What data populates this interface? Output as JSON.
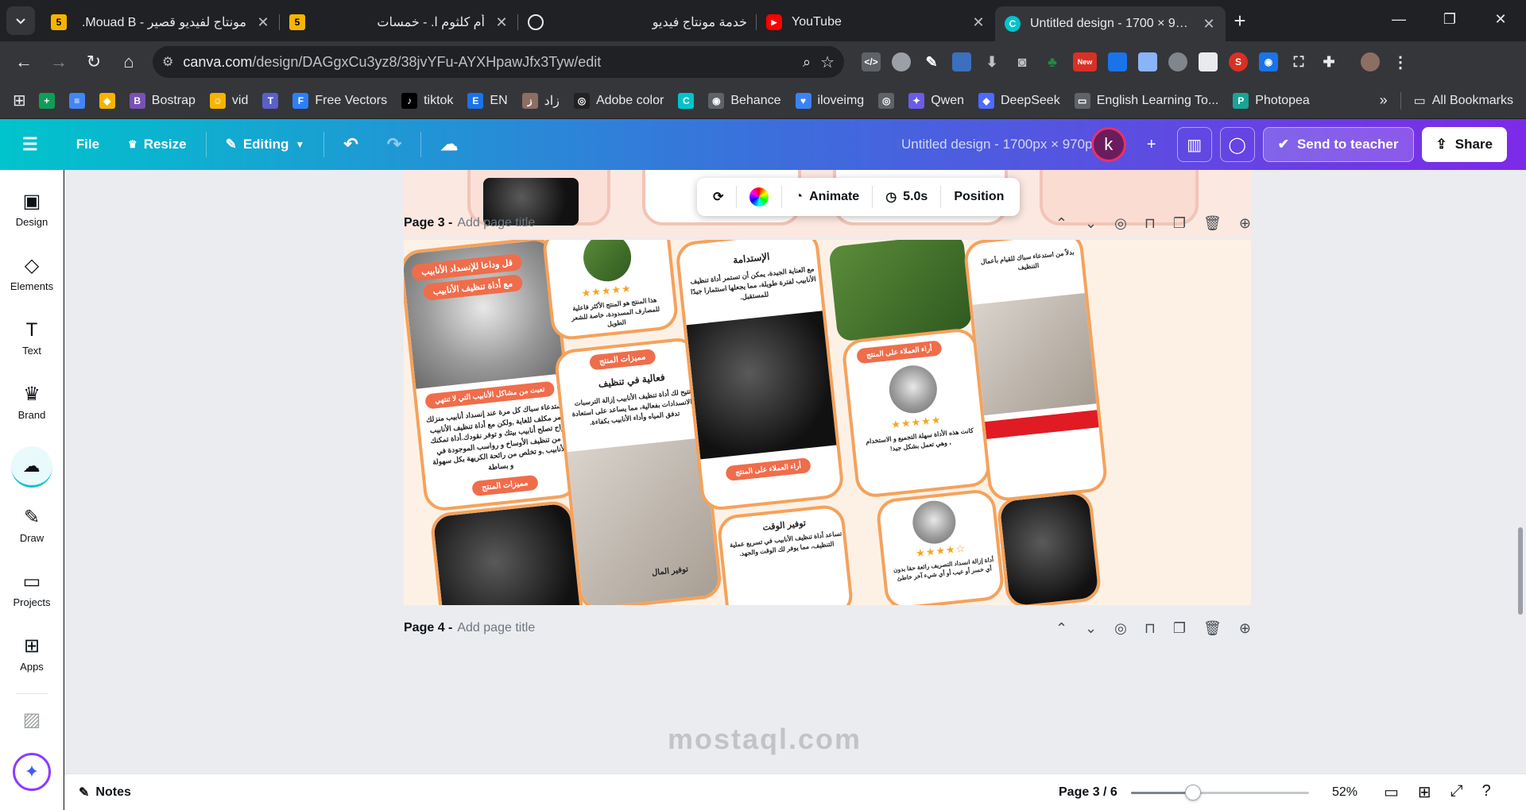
{
  "browser": {
    "tabs": [
      {
        "title": "مونتاج لفيديو قصير - Mouad B.",
        "favicon": "5",
        "favicon_color": "#f5b400"
      },
      {
        "title": "أم كلثوم ا. - خمسات",
        "favicon": "5",
        "favicon_color": "#f5b400"
      },
      {
        "title": "خدمة مونتاج فيديو",
        "favicon": "",
        "favicon_color": "#202124"
      },
      {
        "title": "YouTube",
        "favicon": "▶",
        "favicon_color": "#ff0000"
      },
      {
        "title": "Untitled design - 1700 × 970px",
        "favicon": "C",
        "favicon_color": "#00c4cc"
      }
    ],
    "url_host": "canva.com",
    "url_path": "/design/DAGgxCu3yz8/38jvYFu-AYXHpawJfx3Tyw/edit",
    "extension_badge": "New",
    "bookmarks": [
      {
        "label": "",
        "icon_color": "#0f9d58",
        "glyph": "+"
      },
      {
        "label": "",
        "icon_color": "#4285f4",
        "glyph": "≡"
      },
      {
        "label": "",
        "icon_color": "#f5b400",
        "glyph": "◆"
      },
      {
        "label": "Bostrap",
        "icon_color": "#7952b3",
        "glyph": "B"
      },
      {
        "label": "vid",
        "icon_color": "#f5b400",
        "glyph": "☺"
      },
      {
        "label": "",
        "icon_color": "#5b5fc7",
        "glyph": "T"
      },
      {
        "label": "Free Vectors",
        "icon_color": "#2d7ff9",
        "glyph": "F"
      },
      {
        "label": "tiktok",
        "icon_color": "#000000",
        "glyph": "♪"
      },
      {
        "label": "EN",
        "icon_color": "#1a73e8",
        "glyph": "E"
      },
      {
        "label": "زاد",
        "icon_color": "#8d6e63",
        "glyph": "ز"
      },
      {
        "label": "Adobe color",
        "icon_color": "#222222",
        "glyph": "◎"
      },
      {
        "label": "",
        "icon_color": "#00c4cc",
        "glyph": "C"
      },
      {
        "label": "Behance",
        "icon_color": "#5f6368",
        "glyph": "◉"
      },
      {
        "label": "iloveimg",
        "icon_color": "#3b82f6",
        "glyph": "♥"
      },
      {
        "label": "",
        "icon_color": "#5f6368",
        "glyph": "◎"
      },
      {
        "label": "Qwen",
        "icon_color": "#6b5ce7",
        "glyph": "✦"
      },
      {
        "label": "DeepSeek",
        "icon_color": "#4d6bfe",
        "glyph": "◆"
      },
      {
        "label": "English Learning To...",
        "icon_color": "#5f6368",
        "glyph": "▭"
      },
      {
        "label": "Photopea",
        "icon_color": "#18a497",
        "glyph": "P"
      }
    ],
    "all_bookmarks": "All Bookmarks"
  },
  "canva": {
    "menu": {
      "file": "File",
      "resize": "Resize",
      "editing": "Editing"
    },
    "doc_title": "Untitled design - 1700px × 970px",
    "avatar_letter": "k",
    "send_to_teacher": "Send to teacher",
    "share": "Share",
    "rail": [
      {
        "label": "Design",
        "icon": "▣"
      },
      {
        "label": "Elements",
        "icon": "◇"
      },
      {
        "label": "Text",
        "icon": "T"
      },
      {
        "label": "Brand",
        "icon": "♛"
      },
      {
        "label": "",
        "icon": "☁"
      },
      {
        "label": "Draw",
        "icon": "✎"
      },
      {
        "label": "Projects",
        "icon": "▭"
      },
      {
        "label": "Apps",
        "icon": "⊞"
      }
    ],
    "floating_toolbar": {
      "animate": "Animate",
      "duration": "5.0s",
      "position": "Position"
    },
    "pages": [
      {
        "title": "Page 3 -",
        "add_title": "Add page title"
      },
      {
        "title": "Page 4 -",
        "add_title": "Add page title"
      }
    ],
    "design_text": {
      "headline1": "قل وداعا للإنسداد الأنابيب",
      "headline2": "مع أداة تنظيف الأنابيب",
      "tired": "تعبت من مشاكل الأنابيب التي لا تنتهي",
      "body1": "إستدعاء سباك كل مرة عند إنسداد أنابيب منزلك أمر مكلف للغاية ,ولكن مع أداة تنظيف الأنابيب راح تصلح أنابيب بيتك و توفر نقودك.أداة تمكنك من تنظيف الأوساخ و رواسب الموجودة في الأنابيب ,و تخلص من رائحة الكريهة بكل سهولة و بساطة",
      "features": "مميزات المنتج",
      "effective": "فعالية في تنظيف",
      "effective_body": "تتيح لك أداة تنظيف الأنابيب إزالة الترسبات والانسدادات بفعالية، مما يساعد على استعادة تدفق المياه وأداء الأنابيب بكفاءة.",
      "review1": "هذا المنتج هو المنتج الأكثر فاعلية للمصارف المسدودة، خاصة للشعر الطويل",
      "sustain": "الإستدامة",
      "sustain_body": "مع العناية الجيدة، يمكن أن تستمر أداة تنظيف الأنابيب لفترة طويلة، مما يجعلها استثمارا جيدًا للمستقبل.",
      "opinions": "أراء العملاء على المنتج",
      "time": "توفير الوقت",
      "time_body": "تساعد أداة تنظيف الأنابيب في تسريع عملية التنظيف، مما يوفر لك الوقت والجهد.",
      "money": "توفير المال",
      "money_body": "بدلاً من استدعاء سباك للقيام بأعمال التنظيف",
      "review2": "كانت هذه الأداة سهلة التجميع و الاستخدام ، وهي تعمل بشكل جيد!",
      "review3": "أداة إزالة انسداد التصريف رائعة حقا بدون أي خسر أو عيب أو أي شيء آخر خاطئ"
    },
    "bottom": {
      "notes": "Notes",
      "pager": "Page 3 / 6",
      "zoom": "52%",
      "zoom_level": 0.52
    }
  },
  "watermark": "mostaql.com"
}
